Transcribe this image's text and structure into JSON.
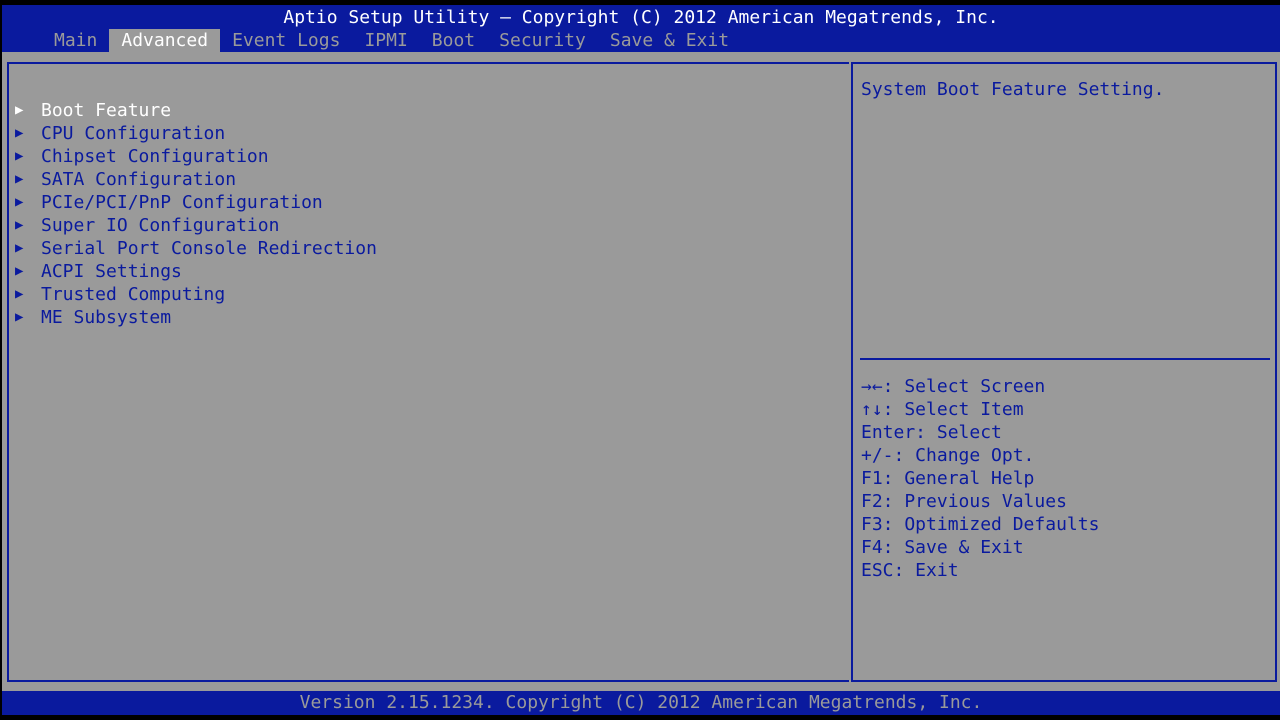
{
  "header": {
    "title": "Aptio Setup Utility – Copyright (C) 2012 American Megatrends, Inc.",
    "tabs": [
      {
        "label": "Main"
      },
      {
        "label": "Advanced"
      },
      {
        "label": "Event Logs"
      },
      {
        "label": "IPMI"
      },
      {
        "label": "Boot"
      },
      {
        "label": "Security"
      },
      {
        "label": "Save & Exit"
      }
    ],
    "active_tab": "Advanced"
  },
  "menu": {
    "arrow_glyph": "▶",
    "items": [
      {
        "label": "Boot Feature"
      },
      {
        "label": "CPU Configuration"
      },
      {
        "label": "Chipset Configuration"
      },
      {
        "label": "SATA Configuration"
      },
      {
        "label": "PCIe/PCI/PnP Configuration"
      },
      {
        "label": "Super IO Configuration"
      },
      {
        "label": "Serial Port Console Redirection"
      },
      {
        "label": "ACPI Settings"
      },
      {
        "label": "Trusted Computing"
      },
      {
        "label": "ME Subsystem"
      }
    ],
    "selected_item": "Boot Feature"
  },
  "help": {
    "text": "System Boot Feature Setting."
  },
  "keys": [
    {
      "text": "→←: Select Screen"
    },
    {
      "text": "↑↓: Select Item"
    },
    {
      "text": "Enter: Select"
    },
    {
      "text": "+/-: Change Opt."
    },
    {
      "text": "F1: General Help"
    },
    {
      "text": "F2: Previous Values"
    },
    {
      "text": "F3: Optimized Defaults"
    },
    {
      "text": "F4: Save & Exit"
    },
    {
      "text": "ESC: Exit"
    }
  ],
  "footer": {
    "version": "Version 2.15.1234. Copyright (C) 2012 American Megatrends, Inc."
  },
  "colors": {
    "bar_blue": "#0a1a9e",
    "panel_gray": "#9a9a9a",
    "selected_text": "#ffffff"
  }
}
